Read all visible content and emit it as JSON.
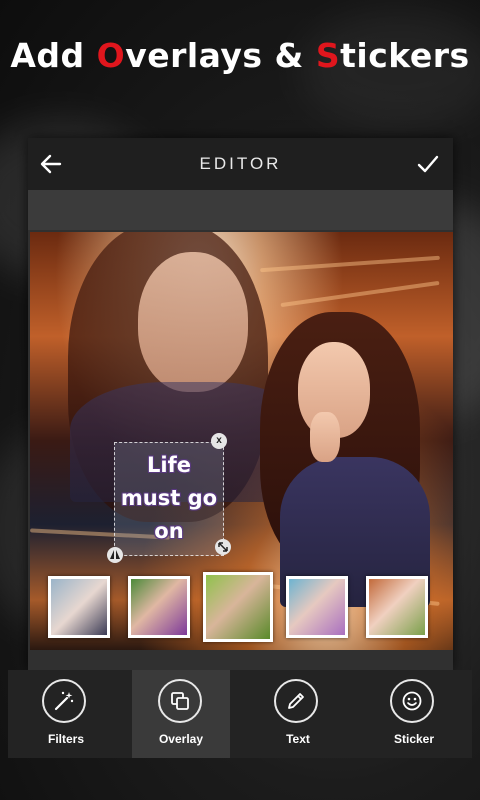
{
  "headline": {
    "part1": "Add ",
    "part2": "O",
    "part3": "verlays & ",
    "part4": "S",
    "part5": "tickers",
    "accent_color": "#e0161d"
  },
  "editor": {
    "title": "EDITOR",
    "back_icon": "back-arrow-icon",
    "confirm_icon": "checkmark-icon"
  },
  "sticker": {
    "lines": [
      "Life",
      "must go",
      "on"
    ],
    "close_label": "x"
  },
  "thumbnails": [
    {
      "name": "couple",
      "selected": false
    },
    {
      "name": "woman-purple",
      "selected": false
    },
    {
      "name": "woman-garden",
      "selected": true
    },
    {
      "name": "woman-blue",
      "selected": false
    },
    {
      "name": "woman-flowers",
      "selected": false
    }
  ],
  "tools": [
    {
      "label": "Filters",
      "icon": "magic-wand-icon",
      "active": false
    },
    {
      "label": "Overlay",
      "icon": "overlay-icon",
      "active": true
    },
    {
      "label": "Text",
      "icon": "pencil-icon",
      "active": false
    },
    {
      "label": "Sticker",
      "icon": "smiley-icon",
      "active": false
    }
  ]
}
